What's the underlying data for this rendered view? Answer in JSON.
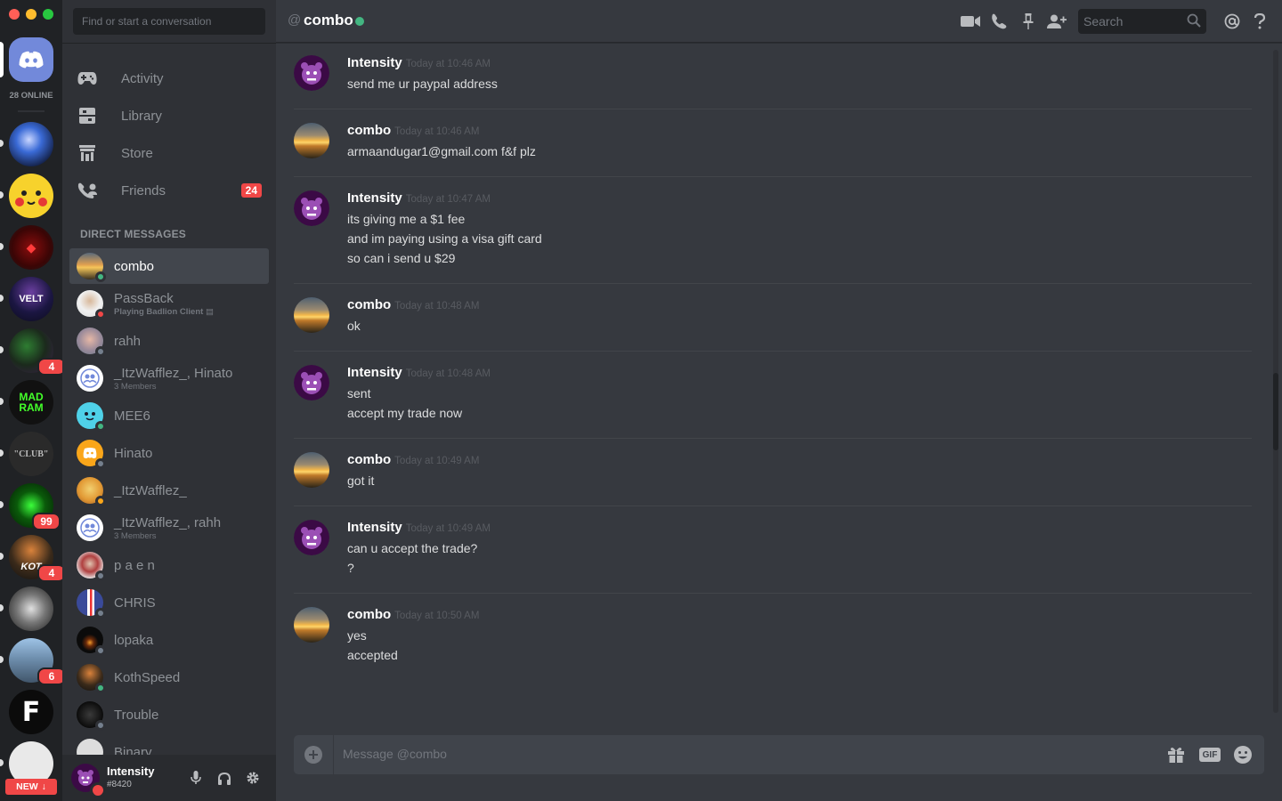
{
  "window": {
    "controls": [
      "close",
      "minimize",
      "maximize"
    ]
  },
  "guilds": {
    "online_label": "28 ONLINE",
    "new_label": "NEW",
    "badges": [
      "4",
      "99",
      "4",
      "6"
    ]
  },
  "sidebar": {
    "search_placeholder": "Find or start a conversation",
    "nav": [
      {
        "label": "Activity",
        "icon": "gamepad-icon"
      },
      {
        "label": "Library",
        "icon": "library-icon"
      },
      {
        "label": "Store",
        "icon": "store-icon"
      },
      {
        "label": "Friends",
        "icon": "friends-icon",
        "badge": "24"
      }
    ],
    "dm_header": "DIRECT MESSAGES",
    "dms": [
      {
        "name": "combo",
        "status": "online",
        "active": true
      },
      {
        "name": "PassBack",
        "sub": "Playing Badlion Client",
        "status": "dnd"
      },
      {
        "name": "rahh",
        "status": "offline"
      },
      {
        "name": "_ItzWafflez_, Hinato",
        "sub": "3 Members",
        "group": true
      },
      {
        "name": "MEE6",
        "status": "online"
      },
      {
        "name": "Hinato",
        "status": "offline"
      },
      {
        "name": "_ItzWafflez_",
        "status": "idle"
      },
      {
        "name": "_ItzWafflez_, rahh",
        "sub": "3 Members",
        "group": true
      },
      {
        "name": "p a e n",
        "status": "offline"
      },
      {
        "name": "CHRIS",
        "status": "offline"
      },
      {
        "name": "lopaka",
        "status": "offline"
      },
      {
        "name": "KothSpeed",
        "status": "online"
      },
      {
        "name": "Trouble",
        "status": "offline"
      },
      {
        "name": "Binary",
        "status": "offline"
      }
    ]
  },
  "user_panel": {
    "name": "Intensity",
    "tag": "#8420"
  },
  "header": {
    "at": "@",
    "channel": "combo",
    "search_placeholder": "Search"
  },
  "messages": [
    {
      "author": "Intensity",
      "time": "Today at 10:46 AM",
      "lines": [
        "send me ur paypal address"
      ]
    },
    {
      "author": "combo",
      "time": "Today at 10:46 AM",
      "lines": [
        "armaandugar1@gmail.com f&f plz"
      ]
    },
    {
      "author": "Intensity",
      "time": "Today at 10:47 AM",
      "lines": [
        "its giving me a $1 fee",
        "and im paying using a visa gift card",
        "so can i send u $29"
      ]
    },
    {
      "author": "combo",
      "time": "Today at 10:48 AM",
      "lines": [
        "ok"
      ]
    },
    {
      "author": "Intensity",
      "time": "Today at 10:48 AM",
      "lines": [
        "sent",
        "accept my trade now"
      ]
    },
    {
      "author": "combo",
      "time": "Today at 10:49 AM",
      "lines": [
        "got it"
      ]
    },
    {
      "author": "Intensity",
      "time": "Today at 10:49 AM",
      "lines": [
        "can u accept the trade?",
        "?"
      ]
    },
    {
      "author": "combo",
      "time": "Today at 10:50 AM",
      "lines": [
        "yes",
        "accepted"
      ]
    }
  ],
  "composer": {
    "placeholder": "Message @combo",
    "gif_label": "GIF"
  },
  "colors": {
    "online": "#43b581",
    "dnd": "#f04747",
    "idle": "#faa61a",
    "offline": "#747f8d",
    "blurple": "#7289da"
  }
}
